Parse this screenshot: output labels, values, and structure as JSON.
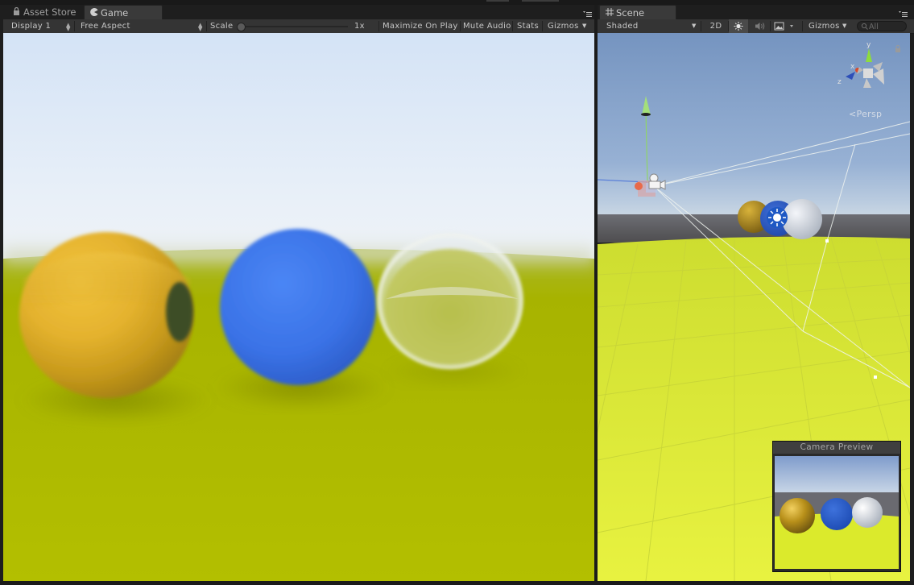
{
  "tabs": {
    "left": [
      {
        "label": "Asset Store",
        "icon": "lock-icon",
        "active": false
      },
      {
        "label": "Game",
        "icon": "pacman-icon",
        "active": true
      }
    ],
    "right": [
      {
        "label": "Scene",
        "icon": "grid-icon",
        "active": true
      }
    ]
  },
  "game_toolbar": {
    "display": "Display 1",
    "aspect": "Free Aspect",
    "scale_label": "Scale",
    "scale_value": "1x",
    "maximize": "Maximize On Play",
    "mute": "Mute Audio",
    "stats": "Stats",
    "gizmos": "Gizmos"
  },
  "scene_toolbar": {
    "shading": "Shaded",
    "mode_2d": "2D",
    "gizmos": "Gizmos",
    "search_placeholder": "All",
    "icons": [
      "sun-icon",
      "speaker-icon",
      "image-icon"
    ]
  },
  "scene": {
    "persp_label": "Persp",
    "gizmo_axes": [
      "y",
      "x",
      "z"
    ]
  },
  "camera_preview": {
    "title": "Camera Preview"
  },
  "colors": {
    "sky_top": "#d9e7f5",
    "ground": "#b5c000",
    "gold_sphere": "#e7b52f",
    "blue_sphere": "#3f7bf0",
    "glass_sphere": "#e6eef0",
    "scene_sky": "#7f9dc8",
    "scene_ground": "#e0ee30",
    "panel_bg": "#343434",
    "tab_active": "#3a3a3a"
  }
}
